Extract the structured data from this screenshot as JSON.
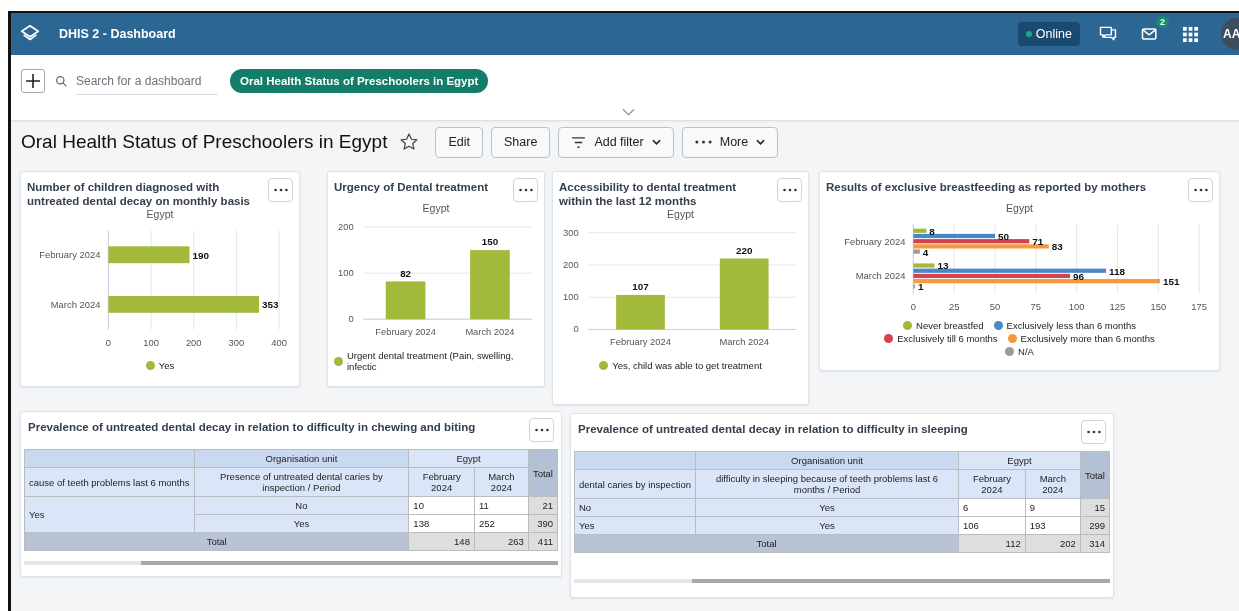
{
  "header": {
    "title": "DHIS 2 - Dashboard",
    "status": {
      "label": "Online",
      "online": true
    },
    "messages_badge": "2",
    "avatar": "AA"
  },
  "controls": {
    "search": {
      "placeholder": "Search for a dashboard"
    },
    "dashboards": [
      {
        "label": "Oral Health Status of Preschoolers in Egypt",
        "selected": true
      }
    ]
  },
  "dashboard": {
    "title": "Oral Health Status of Preschoolers in Egypt",
    "starred": false,
    "buttons": [
      {
        "label": "Edit",
        "kind": "plain"
      },
      {
        "label": "Share",
        "kind": "plain"
      },
      {
        "label": "Add filter",
        "kind": "filter"
      },
      {
        "label": "More",
        "kind": "more"
      }
    ]
  },
  "charts": [
    {
      "title": "Number of children diagnosed with untreated dental decay on monthly basis",
      "chart_data": {
        "type": "bar",
        "orientation": "horizontal",
        "title": "Egypt",
        "categories": [
          "February 2024",
          "March 2024"
        ],
        "series": [
          {
            "name": "Yes",
            "color": "#a2ba3c",
            "values": [
              190,
              353
            ]
          }
        ],
        "xlim": [
          0,
          400
        ],
        "xticks": [
          0,
          100,
          200,
          300,
          400
        ],
        "grid": true,
        "data_labels": true
      }
    },
    {
      "title": "Urgency of Dental treatment",
      "chart_data": {
        "type": "bar",
        "orientation": "vertical",
        "title": "Egypt",
        "categories": [
          "February 2024",
          "March 2024"
        ],
        "series": [
          {
            "name": "Urgent dental treatment (Pain, swelling, infectic",
            "color": "#a2ba3c",
            "values": [
              82,
              150
            ]
          }
        ],
        "ylim": [
          0,
          200
        ],
        "yticks": [
          0,
          100,
          200
        ],
        "grid": true,
        "data_labels": true
      }
    },
    {
      "title": "Accessibility to dental treatment within the last 12 months",
      "chart_data": {
        "type": "bar",
        "orientation": "vertical",
        "title": "Egypt",
        "categories": [
          "February 2024",
          "March 2024"
        ],
        "series": [
          {
            "name": "Yes, child was able to get treatment",
            "color": "#a2ba3c",
            "values": [
              107,
              220
            ]
          }
        ],
        "ylim": [
          0,
          300
        ],
        "yticks": [
          0,
          100,
          200,
          300
        ],
        "grid": true,
        "data_labels": true
      }
    },
    {
      "title": "Results of exclusive breastfeeding as reported by mothers",
      "chart_data": {
        "type": "bar",
        "orientation": "horizontal",
        "title": "Egypt",
        "categories": [
          "February 2024",
          "March 2024"
        ],
        "series": [
          {
            "name": "Never breastfed",
            "color": "#a2ba3c",
            "values": [
              8,
              13
            ]
          },
          {
            "name": "Exclusively less than 6 months",
            "color": "#4a86c8",
            "values": [
              50,
              118
            ]
          },
          {
            "name": "Exclusively till 6 months",
            "color": "#d6414f",
            "values": [
              71,
              96
            ]
          },
          {
            "name": "Exclusively more than 6 months",
            "color": "#f7983a",
            "values": [
              83,
              151
            ]
          },
          {
            "name": "N/A",
            "color": "#9a9a9a",
            "values": [
              4,
              1
            ]
          }
        ],
        "xlim": [
          0,
          175
        ],
        "xticks": [
          0,
          25,
          50,
          75,
          100,
          125,
          150,
          175
        ],
        "grid": true,
        "data_labels": true
      }
    }
  ],
  "tables": [
    {
      "title": "Prevalence of untreated dental decay in relation to difficulty in chewing and biting",
      "header": [
        [
          {
            "kind": "blank"
          },
          {
            "text": "Organisation unit",
            "kind": "head"
          },
          {
            "text": "Egypt",
            "kind": "subhead",
            "colspan": 2
          },
          {
            "text": "Total",
            "kind": "total-head",
            "rowspan": 2
          }
        ],
        [
          {
            "text": "cause of teeth problems last 6 months",
            "kind": "subhead-cut"
          },
          {
            "text": "Presence of untreated dental caries by inspection / Period",
            "kind": "subhead"
          },
          {
            "text": "February 2024",
            "kind": "subhead"
          },
          {
            "text": "March 2024",
            "kind": "subhead"
          }
        ]
      ],
      "body": [
        [
          {
            "text": "Yes",
            "kind": "label",
            "rowspan": 2
          },
          {
            "text": "No",
            "kind": "label-center"
          },
          {
            "text": "10",
            "kind": "value"
          },
          {
            "text": "11",
            "kind": "value"
          },
          {
            "text": "21",
            "kind": "total"
          }
        ],
        [
          {
            "text": "Yes",
            "kind": "label-center"
          },
          {
            "text": "138",
            "kind": "value"
          },
          {
            "text": "252",
            "kind": "value"
          },
          {
            "text": "390",
            "kind": "total"
          }
        ],
        [
          {
            "text": "Total",
            "kind": "total-label",
            "colspan": 2
          },
          {
            "text": "148",
            "kind": "total"
          },
          {
            "text": "263",
            "kind": "total"
          },
          {
            "text": "411",
            "kind": "total"
          }
        ]
      ]
    },
    {
      "title": "Prevalence of untreated dental decay in relation to difficulty in sleeping",
      "header": [
        [
          {
            "kind": "blank"
          },
          {
            "text": "Organisation unit",
            "kind": "head"
          },
          {
            "text": "Egypt",
            "kind": "subhead",
            "colspan": 2
          },
          {
            "text": "Total",
            "kind": "total-head",
            "rowspan": 2
          }
        ],
        [
          {
            "text": "dental caries by inspection",
            "kind": "subhead-cut"
          },
          {
            "text": "difficulty in sleeping because of teeth problems last 6 months / Period",
            "kind": "subhead"
          },
          {
            "text": "February 2024",
            "kind": "subhead"
          },
          {
            "text": "March 2024",
            "kind": "subhead"
          }
        ]
      ],
      "body": [
        [
          {
            "text": "No",
            "kind": "label"
          },
          {
            "text": "Yes",
            "kind": "label-center"
          },
          {
            "text": "6",
            "kind": "value"
          },
          {
            "text": "9",
            "kind": "value"
          },
          {
            "text": "15",
            "kind": "total"
          }
        ],
        [
          {
            "text": "Yes",
            "kind": "label"
          },
          {
            "text": "Yes",
            "kind": "label-center"
          },
          {
            "text": "106",
            "kind": "value"
          },
          {
            "text": "193",
            "kind": "value"
          },
          {
            "text": "299",
            "kind": "total"
          }
        ],
        [
          {
            "text": "Total",
            "kind": "total-label",
            "colspan": 2
          },
          {
            "text": "112",
            "kind": "total"
          },
          {
            "text": "202",
            "kind": "total"
          },
          {
            "text": "314",
            "kind": "total"
          }
        ]
      ]
    }
  ]
}
